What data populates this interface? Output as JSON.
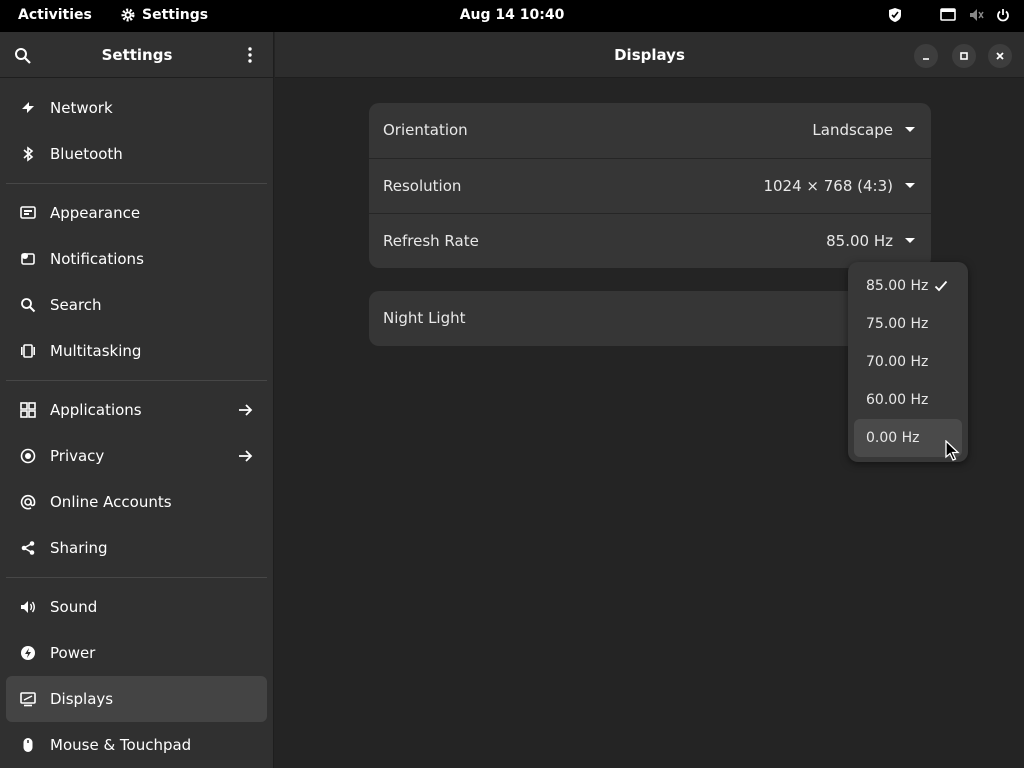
{
  "topbar": {
    "activities": "Activities",
    "app_name": "Settings",
    "clock": "Aug 14  10:40"
  },
  "sidebar": {
    "title": "Settings",
    "items": [
      {
        "label": "Network",
        "icon": "network-icon"
      },
      {
        "label": "Bluetooth",
        "icon": "bluetooth-icon"
      },
      {
        "label": "Appearance",
        "icon": "appearance-icon"
      },
      {
        "label": "Notifications",
        "icon": "notifications-icon"
      },
      {
        "label": "Search",
        "icon": "search-icon"
      },
      {
        "label": "Multitasking",
        "icon": "multitasking-icon"
      },
      {
        "label": "Applications",
        "icon": "applications-icon"
      },
      {
        "label": "Privacy",
        "icon": "privacy-icon"
      },
      {
        "label": "Online Accounts",
        "icon": "online-accounts-icon"
      },
      {
        "label": "Sharing",
        "icon": "sharing-icon"
      },
      {
        "label": "Sound",
        "icon": "sound-icon"
      },
      {
        "label": "Power",
        "icon": "power-icon"
      },
      {
        "label": "Displays",
        "icon": "displays-icon",
        "active": true
      },
      {
        "label": "Mouse & Touchpad",
        "icon": "mouse-icon"
      }
    ]
  },
  "main": {
    "title": "Displays",
    "settings": {
      "orientation": {
        "label": "Orientation",
        "value": "Landscape"
      },
      "resolution": {
        "label": "Resolution",
        "value": "1024 × 768 (4:3)"
      },
      "refresh_rate": {
        "label": "Refresh Rate",
        "value": "85.00 Hz"
      }
    },
    "night_light": {
      "label": "Night Light"
    }
  },
  "refresh_popover": {
    "options": [
      "85.00 Hz",
      "75.00 Hz",
      "70.00 Hz",
      "60.00 Hz",
      "0.00 Hz"
    ],
    "selected": "85.00 Hz",
    "hovered": "0.00 Hz"
  },
  "colors": {
    "topbar_bg": "#000000",
    "sidebar_bg": "#303030",
    "main_bg": "#242424",
    "card_bg": "#363636",
    "active_item_bg": "#444444"
  }
}
